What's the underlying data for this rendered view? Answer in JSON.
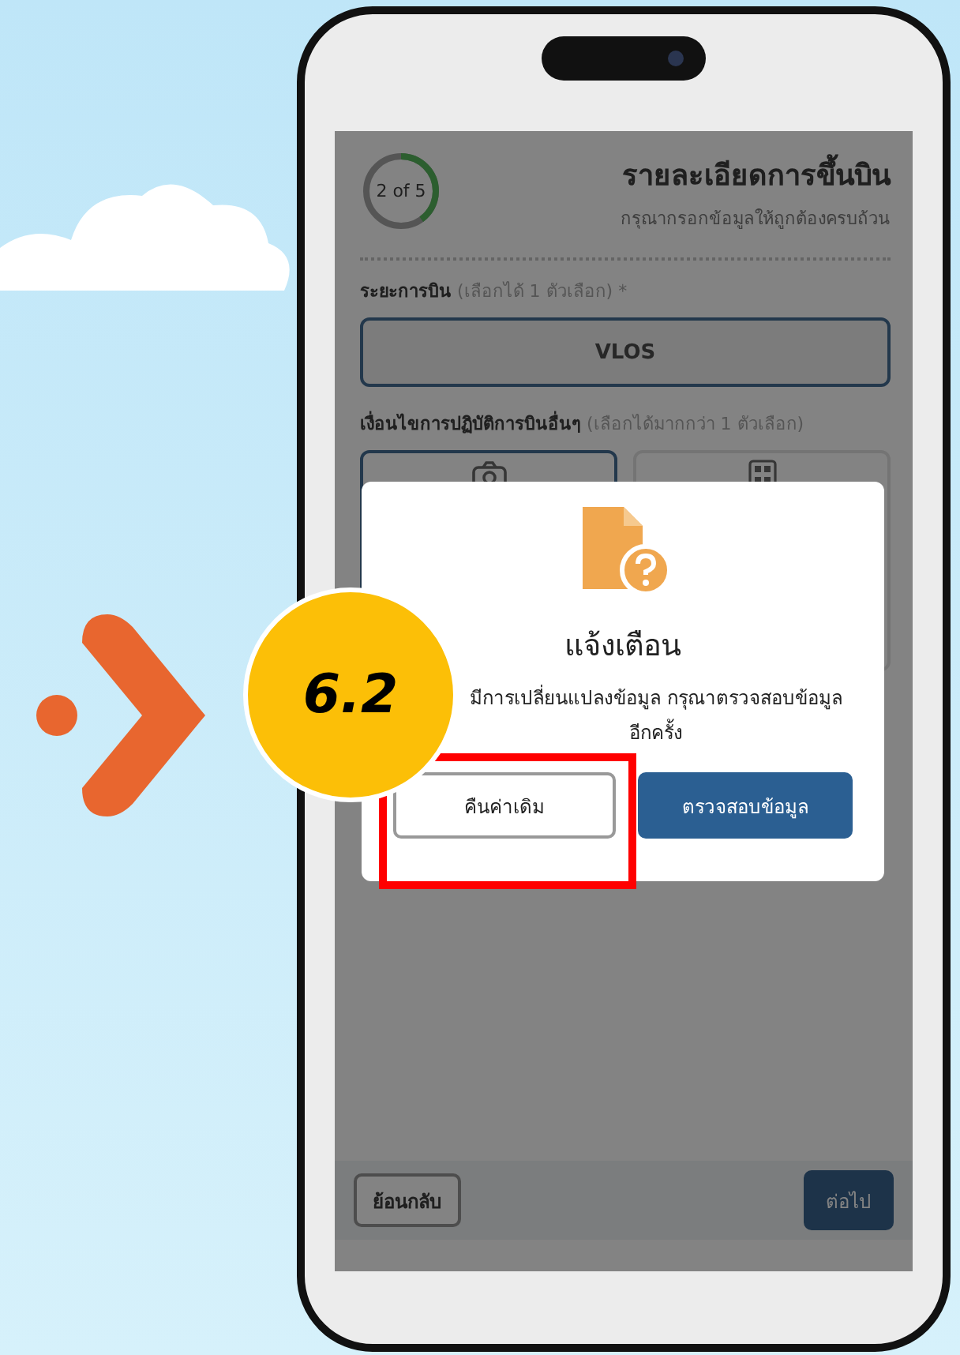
{
  "annotation": {
    "step": "6.2"
  },
  "screen": {
    "progress": {
      "label": "2 of 5",
      "level": 0.4
    },
    "title": "รายละเอียดการขึ้นบิน",
    "subtitle": "กรุณากรอกข้อมูลให้ถูกต้องครบถ้วน",
    "flight_range": {
      "label": "**ระยะการบิน** (เลือกได้ 1 ตัวเลือก) *",
      "options": [
        {
          "label": "VLOS",
          "selected": true
        }
      ]
    },
    "conditions": {
      "label": "**เงื่อนไขการปฏิบัติการบินอื่นๆ** (เลือกได้มากกว่า 1 ตัวเลือก)",
      "options": [
        {
          "kind": "camera",
          "selected": true
        },
        {
          "kind": "grid",
          "selected": false
        }
      ]
    },
    "footer": {
      "back": "ย้อนกลับ",
      "next": "ต่อไป"
    }
  },
  "dialog": {
    "title": "แจ้งเตือน",
    "message": "มีการเปลี่ยนแปลงข้อมูล กรุณาตรวจสอบข้อมูล อีกครั้ง",
    "buttons": [
      {
        "label": "คืนค่าเดิม",
        "kind": "outline"
      },
      {
        "label": "ตรวจสอบข้อมูล",
        "kind": "primary"
      }
    ]
  }
}
